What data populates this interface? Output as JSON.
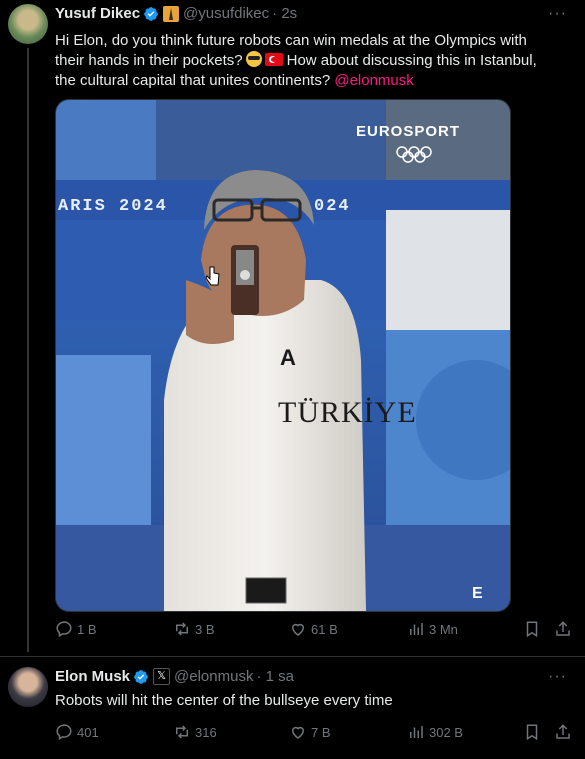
{
  "tweet1": {
    "name": "Yusuf Dikec",
    "handle": "@yusufdikec",
    "time": "· 2s",
    "text_line1": "Hi Elon, do you think future robots can win medals at the Olympics with",
    "text_line2_a": "their hands in their pockets?",
    "text_line2_b": "How about discussing this in Istanbul,",
    "text_line3": "the cultural capital that unites continents?",
    "mention": "@elonmusk",
    "image": {
      "brand": "EUROSPORT",
      "banner_left": "ARIS 2024",
      "banner_right": "024",
      "shirt_text": "TÜRKİYE",
      "watermark": "E"
    },
    "stats": {
      "replies": "1 B",
      "reposts": "3 B",
      "likes": "61 B",
      "views": "3 Mn"
    }
  },
  "tweet2": {
    "name": "Elon Musk",
    "handle": "@elonmusk",
    "time": "· 1 sa",
    "text": "Robots will hit the center of the bullseye every time",
    "stats": {
      "replies": "401",
      "reposts": "316",
      "likes": "7 B",
      "views": "302 B"
    }
  },
  "colors": {
    "background": "#000000",
    "muted": "#71767b",
    "verified": "#1d9bf0",
    "mention": "#f91880"
  }
}
